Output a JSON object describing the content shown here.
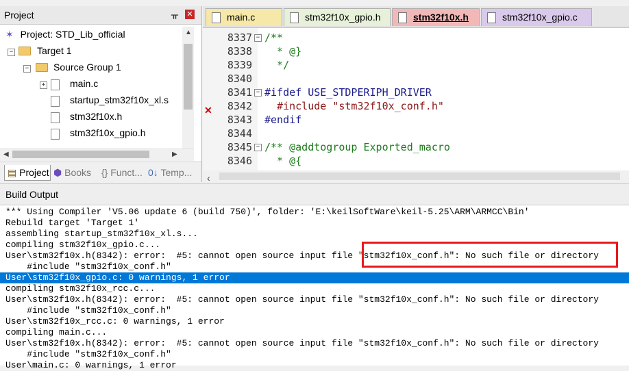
{
  "project": {
    "title": "Project",
    "tree": {
      "root": "Project: STD_Lib_official",
      "target": "Target 1",
      "group": "Source Group 1",
      "files": [
        "main.c",
        "startup_stm32f10x_xl.s",
        "stm32f10x.h",
        "stm32f10x_gpio.h"
      ]
    },
    "tabs": [
      "Project",
      "Books",
      "{} Funct...",
      "Temp..."
    ]
  },
  "editor": {
    "tabs": [
      {
        "label": "main.c",
        "color": "#f5e8a8"
      },
      {
        "label": "stm32f10x_gpio.h",
        "color": "#e7f1d9"
      },
      {
        "label": "stm32f10x.h",
        "color": "#f2b8b8"
      },
      {
        "label": "stm32f10x_gpio.c",
        "color": "#d9c9ea"
      }
    ],
    "lines": [
      {
        "num": "8337",
        "text": "/**"
      },
      {
        "num": "8338",
        "text": "  * @}"
      },
      {
        "num": "8339",
        "text": "  */"
      },
      {
        "num": "8340",
        "text": ""
      },
      {
        "num": "8341",
        "text": "#ifdef USE_STDPERIPH_DRIVER"
      },
      {
        "num": "8342",
        "text": "  #include \"stm32f10x_conf.h\""
      },
      {
        "num": "8343",
        "text": "#endif"
      },
      {
        "num": "8344",
        "text": ""
      },
      {
        "num": "8345",
        "text": "/** @addtogroup Exported_macro"
      },
      {
        "num": "8346",
        "text": "  * @{"
      }
    ]
  },
  "build": {
    "title": "Build Output",
    "lines": [
      "*** Using Compiler 'V5.06 update 6 (build 750)', folder: 'E:\\keilSoftWare\\keil-5.25\\ARM\\ARMCC\\Bin'",
      "Rebuild target 'Target 1'",
      "assembling startup_stm32f10x_xl.s...",
      "compiling stm32f10x_gpio.c...",
      "User\\stm32f10x.h(8342): error:  #5: cannot open source input file \"stm32f10x_conf.h\": No such file or directory",
      "    #include \"stm32f10x_conf.h\"",
      "User\\stm32f10x_gpio.c: 0 warnings, 1 error",
      "compiling stm32f10x_rcc.c...",
      "User\\stm32f10x.h(8342): error:  #5: cannot open source input file \"stm32f10x_conf.h\": No such file or directory",
      "    #include \"stm32f10x_conf.h\"",
      "User\\stm32f10x_rcc.c: 0 warnings, 1 error",
      "compiling main.c...",
      "User\\stm32f10x.h(8342): error:  #5: cannot open source input file \"stm32f10x_conf.h\": No such file or directory",
      "    #include \"stm32f10x_conf.h\"",
      "User\\main.c: 0 warnings, 1 error"
    ],
    "selected_line": 6
  }
}
